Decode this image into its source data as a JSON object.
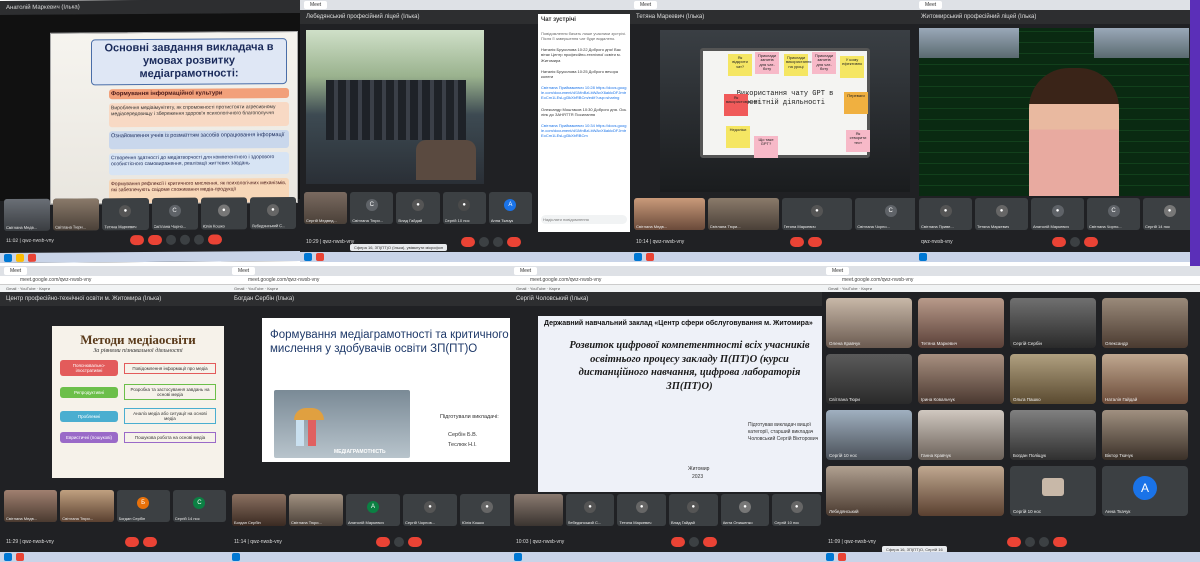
{
  "p1": {
    "title": "Анатолій Маркевич (Ілька)",
    "slide_title": "Основні завдання викладача в умовах розвитку медіаграмотності:",
    "items": [
      "Формування інформаційної культури",
      "Вироблення медіаімунітету, як спроможності протистояти агресивному медіасередовищу і збереження здоров'я психологічного благополуччя",
      "Ознайомлення учнів із розмаїттям засобів опрацювання інформації",
      "Створення здатності до медіатворчості для компетентного і здорового особистісного самовираження, реалізації життєвих завдань",
      "Формування рефлексії і критичного мислення, як психологічних механізмів, які забезпечують свідоме споживання медіа-продукції"
    ],
    "participants": [
      "Світлана Медв...",
      "Світлана Тюри...",
      "Тетяна Маркевич",
      "Світлана Чорно...",
      "Юлія Кошко",
      "Лебедянський С..."
    ],
    "time": "11:02",
    "meeting": "qwz-nwsb-vny"
  },
  "p2": {
    "title": "Лебедянський професійний ліцей (Ілька)",
    "chat_header": "Чат зустрічі",
    "chat_messages": [
      "Повідомлення бачать лише учасники зустрічі. Після її завершення чат буде видалено.",
      "Наталія Брусилова 10:22 Доброго дня! Вас вітає Центр професійно-технічної освіти м. Житомира",
      "Наталія Брусилова 10:25 Доброго вечора колеги",
      "Світлана Приймакевич 10:28 https://docs.google.com/document/d/1MnBzLbWAvX6aklcDFJmtrEoCm1LEsLgI3kXbRBCm/edit?usp=sharing",
      "Олександр Моштаков 10:30 Доброго дня. Ось лінк до ЗАНЯТТЯ Посилання",
      "Світлана Приймакевич 10:34 https://docs.google.com/document/d/1MnBzLbWAvX6aklcDFJmtrEoCm1LEsLgI3kXbRBCm"
    ],
    "chat_input": "Надіслати повідомлення",
    "participants": [
      "Сергій Медвед...",
      "Світлана Тюри...",
      "Тетяна Маркевич",
      "Світлана Чорно...",
      "Влад Гайдай",
      "Сергій 10 нос",
      "Анна Ткачук"
    ],
    "time": "10:29",
    "meeting": "qwz-nwsb-vny",
    "toast": "Сфера 16, ЗП(ПТ)О (Ілька), увімкнути мікрофон"
  },
  "p3": {
    "title": "Тетяна Маркевич (Ілька)",
    "slide_text": "Використання чату GPT в освітній діяльності",
    "notes": [
      "Як відкрити чат?",
      "Приклади запитів для чат-боту",
      "Приклади використання на уроці",
      "Приклади запитів для чат-боту",
      "У кому ефективно",
      "Як використовувати?",
      "Переваги",
      "Недоліки",
      "Що таке GPT?",
      "Як створити тест"
    ],
    "participants": [
      "Світлана Медв...",
      "Світлана Тюри...",
      "Тетяна Маркевич",
      "Світлана Чорно..."
    ],
    "time": "10:14",
    "meeting": "qwz-nwsb-vny"
  },
  "p4": {
    "title": "Житомирський професійний ліцей (Ілька)",
    "participants": [
      "Світлана Приве...",
      "Тетяна Маркевич",
      "Анатолій Маркевич",
      "Світлана Чорно...",
      "Юлія Кошко",
      "Аюта Онишенко",
      "Сергій 14 нос"
    ],
    "time": "",
    "meeting": "qwz-nwsb-vny"
  },
  "p5": {
    "title": "Центр професійно-технічної освіти м. Житомира (Ілька)",
    "slide_title": "Методи медіаосвіти",
    "slide_sub": "За рівнями пізнавальної діяльності",
    "left_items": [
      "Пояснювально-ілюстративні",
      "Репродуктивні",
      "Проблемні",
      "Евристичні (пошукові)"
    ],
    "right_items": [
      "Повідомлення інформації про медіа",
      "Розробка та застосування завдань на основі медіа",
      "Аналіз медіа або ситуації на основі медіа",
      "Пошукова робота на основі медіа"
    ],
    "participants": [
      "Світлана Медв...",
      "Світлана Тюри...",
      "Богдан Сербін",
      "Сергій 14 нос"
    ],
    "time": "11:29",
    "meeting": "qwz-nwsb-vny"
  },
  "p6": {
    "title": "Богдан Сербін (Ілька)",
    "slide_title": "Формування медіаграмотності та критичного мислення у здобувачів освіти ЗП(ПТ)О",
    "prepared": "Підготували викладачі:",
    "authors": [
      "Сербін Б.В.",
      "Теслюк Н.І."
    ],
    "image_caption": "МЕДІАГРАМОТНІСТЬ",
    "participants": [
      "Богдан Сербін",
      "Світлана Тюри...",
      "Анатолій Маркевич",
      "Сергій Чорнов...",
      "Юлія Кошко",
      "Лебедянський С..."
    ],
    "time": "11:14",
    "meeting": "qwz-nwsb-vny"
  },
  "p7": {
    "title": "Сергій Чоловський (Ілька)",
    "slide_header": "Державний навчальний заклад «Центр сфери обслуговування м. Житомира»",
    "slide_title": "Розвиток цифрової компетентності всіх учасників освітнього процесу закладу П(ПТ)О (курси дистанційного навчання, цифрова лабораторія ЗП(ПТ)О)",
    "prepared": "Підготував викладач вищої категорії, старший викладач Чоловський Сергій Вікторович",
    "city": "Житомир",
    "year": "2023",
    "participants": [
      "Лебедянський С...",
      "Тетяна Маркевич",
      "Влад Гайдай",
      "Аюта Онишенко",
      "Сергій 10 нос"
    ],
    "time": "10:03",
    "meeting": "qwz-nwsb-vny"
  },
  "p8": {
    "participants": [
      "Олена Кравчук",
      "Тетяна Маркевич",
      "Сергій Сербін",
      "Олександр",
      "Світлана Тюри",
      "Ірина Ковальчук",
      "Ольга Пашко",
      "Наталія Гайдай",
      "Сергій 10 нос",
      "Ганна Кравчук",
      "Богдан Поліщук",
      "Віктор Ткачук",
      "Лебедянський",
      "Сергій 10 нос",
      "Анна Ткачук"
    ],
    "avatar_letter": "А",
    "time": "11:09",
    "meeting": "qwz-nwsb-vny",
    "toast": "Сфера 16, ЗП(ПТ)О, Сергій 16"
  },
  "colors": {
    "meet_bg": "#202124",
    "red": "#ea4335",
    "accent_purple": "#5b2fb8"
  }
}
